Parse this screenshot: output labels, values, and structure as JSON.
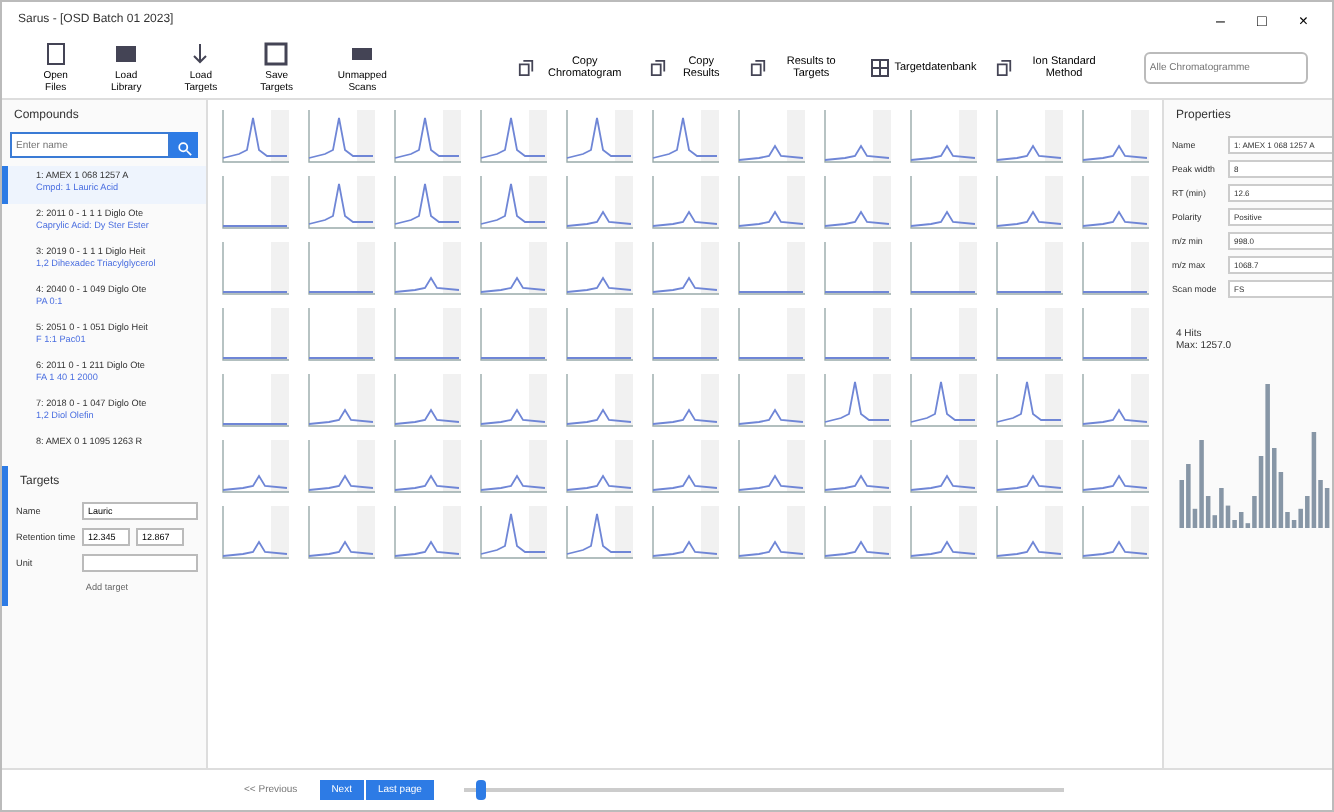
{
  "window": {
    "title": "Sarus - [OSD Batch 01 2023]",
    "controls": [
      "–",
      "□",
      "×"
    ]
  },
  "toolbar_left": [
    {
      "label": "Open Files"
    },
    {
      "label": "Load Library"
    },
    {
      "label": "Load Targets"
    },
    {
      "label": "Save Targets"
    },
    {
      "label": "Unmapped Scans"
    }
  ],
  "toolbar_right": [
    {
      "label": "Copy Chromatogram"
    },
    {
      "label": "Copy Results"
    },
    {
      "label": "Results to Targets"
    },
    {
      "label": "Targetdatenbank"
    },
    {
      "label": "Ion Standard Method"
    }
  ],
  "search": {
    "placeholder": "Alle Chromatogramme"
  },
  "compounds": {
    "title": "Compounds",
    "search_placeholder": "Enter name",
    "items": [
      {
        "name": "1: AMEX 1 068 1257 A",
        "sub": "Cmpd: 1 Lauric Acid",
        "selected": true
      },
      {
        "name": "2: 2011 0 - 1 1 1 Diglo Ote",
        "sub": "Caprylic Acid: Dy Ster Ester",
        "selected": false
      },
      {
        "name": "3: 2019 0 - 1 1 1 Diglo Heit",
        "sub": "1,2 Dihexadec Triacylglycerol",
        "selected": false
      },
      {
        "name": "4: 2040 0 - 1 049 Diglo Ote",
        "sub": "PA 0:1",
        "selected": false
      },
      {
        "name": "5: 2051 0 - 1 051 Diglo Heit",
        "sub": "F 1:1 Pac01",
        "selected": false
      },
      {
        "name": "6: 2011 0 - 1 211 Diglo Ote",
        "sub": "FA 1 40 1 2000",
        "selected": false
      },
      {
        "name": "7: 2018 0 - 1 047 Diglo Ote",
        "sub": "1,2 Diol Olefin",
        "selected": false
      },
      {
        "name": "8: AMEX 0 1 1095 1263 R",
        "selected": false
      }
    ]
  },
  "targets": {
    "title": "Targets",
    "name_label": "Name",
    "name_value": "Lauric",
    "rt_label": "Retention time",
    "rt_from": "12.345",
    "rt_to": "12.867",
    "unit_label": "Unit",
    "add_button": "Add target"
  },
  "chromatograms": [
    {
      "kind": "peak"
    },
    {
      "kind": "peak"
    },
    {
      "kind": "peak"
    },
    {
      "kind": "peak"
    },
    {
      "kind": "peak"
    },
    {
      "kind": "peak"
    },
    {
      "kind": "low"
    },
    {
      "kind": "low"
    },
    {
      "kind": "low"
    },
    {
      "kind": "low"
    },
    {
      "kind": "low"
    },
    {
      "kind": "flat"
    },
    {
      "kind": "peak"
    },
    {
      "kind": "peak"
    },
    {
      "kind": "peak"
    },
    {
      "kind": "low"
    },
    {
      "kind": "low"
    },
    {
      "kind": "low"
    },
    {
      "kind": "low"
    },
    {
      "kind": "low"
    },
    {
      "kind": "low"
    },
    {
      "kind": "low"
    },
    {
      "kind": "flat"
    },
    {
      "kind": "flat"
    },
    {
      "kind": "low"
    },
    {
      "kind": "low"
    },
    {
      "kind": "low"
    },
    {
      "kind": "low"
    },
    {
      "kind": "flat"
    },
    {
      "kind": "flat"
    },
    {
      "kind": "flat"
    },
    {
      "kind": "flat"
    },
    {
      "kind": "flat"
    },
    {
      "kind": "flat"
    },
    {
      "kind": "flat"
    },
    {
      "kind": "flat"
    },
    {
      "kind": "flat"
    },
    {
      "kind": "flat"
    },
    {
      "kind": "flat"
    },
    {
      "kind": "flat"
    },
    {
      "kind": "flat"
    },
    {
      "kind": "flat"
    },
    {
      "kind": "flat"
    },
    {
      "kind": "flat"
    },
    {
      "kind": "flat"
    },
    {
      "kind": "low"
    },
    {
      "kind": "low"
    },
    {
      "kind": "low"
    },
    {
      "kind": "low"
    },
    {
      "kind": "low"
    },
    {
      "kind": "low"
    },
    {
      "kind": "peak"
    },
    {
      "kind": "peak"
    },
    {
      "kind": "peak"
    },
    {
      "kind": "low"
    },
    {
      "kind": "low"
    },
    {
      "kind": "low"
    },
    {
      "kind": "low"
    },
    {
      "kind": "low"
    },
    {
      "kind": "low"
    },
    {
      "kind": "low"
    },
    {
      "kind": "low"
    },
    {
      "kind": "low"
    },
    {
      "kind": "low"
    },
    {
      "kind": "low"
    },
    {
      "kind": "low"
    },
    {
      "kind": "low"
    },
    {
      "kind": "low"
    },
    {
      "kind": "low"
    },
    {
      "kind": "peak"
    },
    {
      "kind": "peak"
    },
    {
      "kind": "low"
    },
    {
      "kind": "low"
    },
    {
      "kind": "low"
    },
    {
      "kind": "low"
    },
    {
      "kind": "low"
    },
    {
      "kind": "low"
    }
  ],
  "properties": {
    "title": "Properties",
    "rows": [
      {
        "label": "Name",
        "value": "1: AMEX 1 068 1257 A"
      },
      {
        "label": "Peak width",
        "value": "8"
      },
      {
        "label": "RT (min)",
        "value": "12.6"
      },
      {
        "label": "Polarity",
        "value": "Positive"
      },
      {
        "label": "m/z min",
        "value": "998.0"
      },
      {
        "label": "m/z max",
        "value": "1068.7"
      },
      {
        "label": "Scan mode",
        "value": "FS"
      }
    ]
  },
  "spectrum": {
    "title": "4 Hits",
    "subtitle": "Max: 1257.0"
  },
  "pager": {
    "previous": "<< Previous",
    "next": "Next",
    "last": "Last page",
    "slider": {
      "level": 0.02
    }
  }
}
